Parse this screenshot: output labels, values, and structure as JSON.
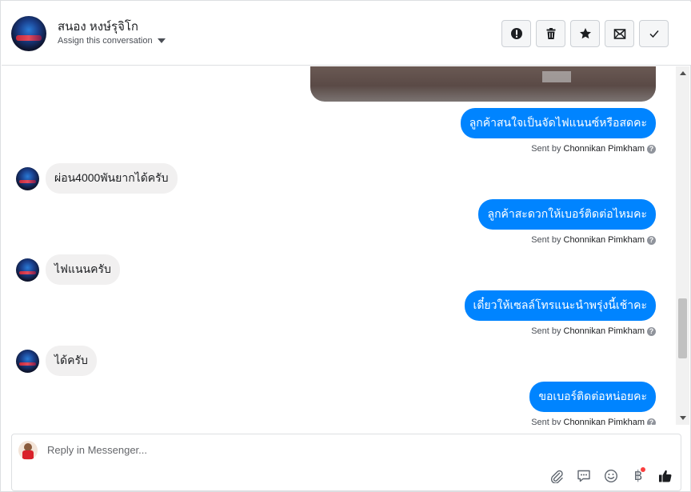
{
  "header": {
    "contact_name": "สนอง หงษ์รุจิโก",
    "assign_label": "Assign this conversation",
    "actions": [
      {
        "name": "mark-as-spam-button",
        "icon": "exclamation-icon"
      },
      {
        "name": "delete-button",
        "icon": "trash-icon"
      },
      {
        "name": "star-button",
        "icon": "star-icon"
      },
      {
        "name": "mark-unread-button",
        "icon": "envelope-icon"
      },
      {
        "name": "mark-done-button",
        "icon": "checkmark-icon"
      }
    ]
  },
  "messages": {
    "m1": {
      "text": "ลูกค้าสนใจเป็นจัดไฟแนนซ์หรือสดคะ",
      "sent_by_prefix": "Sent by",
      "sender": "Chonnikan Pimkham"
    },
    "m2": {
      "text": "ผ่อน4000พันยากได้ครับ"
    },
    "m3": {
      "text": "ลูกค้าสะดวกให้เบอร์ติดต่อไหมคะ",
      "sent_by_prefix": "Sent by",
      "sender": "Chonnikan Pimkham"
    },
    "m4": {
      "text": "ไฟแนนครับ"
    },
    "m5": {
      "text": "เดี๋ยวให้เซลล์โทรแนะนำพรุ่งนี้เช้าคะ",
      "sent_by_prefix": "Sent by",
      "sender": "Chonnikan Pimkham"
    },
    "m6": {
      "text": "ได้ครับ"
    },
    "m7": {
      "text": "ขอเบอร์ติดต่อหน่อยคะ",
      "sent_by_prefix": "Sent by",
      "sender": "Chonnikan Pimkham"
    }
  },
  "composer": {
    "placeholder": "Reply in Messenger...",
    "currency_symbol": "฿"
  },
  "colors": {
    "outgoing_bubble": "#0084ff",
    "incoming_bubble": "#f1f0f0",
    "notification_dot": "#fa3e3e"
  }
}
